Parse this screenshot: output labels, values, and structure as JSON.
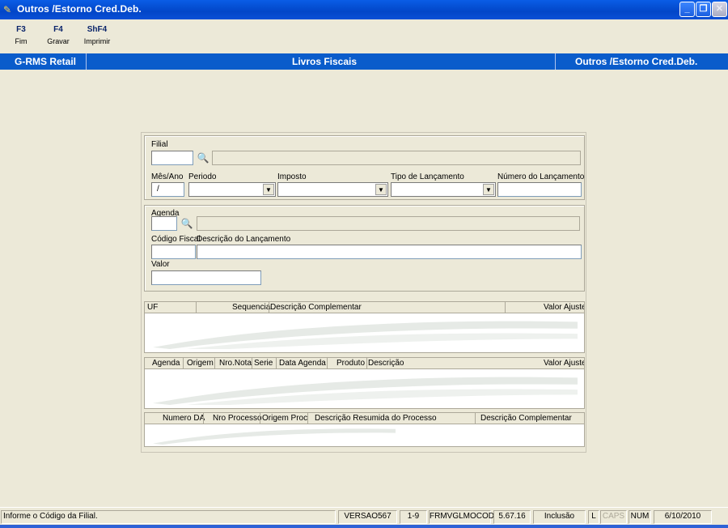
{
  "window": {
    "title": "Outros /Estorno Cred.Deb."
  },
  "fkeys": [
    {
      "key": "F3",
      "label": "Fim"
    },
    {
      "key": "F4",
      "label": "Gravar"
    },
    {
      "key": "ShF4",
      "label": "Imprimir"
    }
  ],
  "band": {
    "left": "G-RMS Retail",
    "center": "Livros Fiscais",
    "right": "Outros /Estorno Cred.Deb."
  },
  "form": {
    "filial_label": "Filial",
    "mes_ano_label": "Mês/Ano",
    "mes_ano_value": "/",
    "periodo_label": "Periodo",
    "imposto_label": "Imposto",
    "tipo_label": "Tipo de Lançamento",
    "numero_label": "Número do Lançamento",
    "agenda_label": "Agenda",
    "codigo_fiscal_label": "Código Fiscal",
    "descricao_label": "Descrição do Lançamento",
    "valor_label": "Valor"
  },
  "grid1": {
    "cols": [
      "UF",
      "Sequencia",
      "Descrição Complementar",
      "Valor Ajuste"
    ]
  },
  "grid2": {
    "cols": [
      "Agenda",
      "Origem",
      "Nro.Nota",
      "Serie",
      "Data Agenda",
      "Produto",
      "Descrição",
      "Valor Ajuste"
    ]
  },
  "grid3": {
    "cols": [
      "Numero DA",
      "Nro Processo",
      "Origem Proc",
      "Descrição Resumida do Processo",
      "Descrição Complementar"
    ]
  },
  "status": {
    "message": "Informe o Código da Filial.",
    "version": "VERSAO567",
    "range": "1-9",
    "form_code": "FRMVGLMOCOD",
    "build": "5.67.16",
    "mode": "Inclusão",
    "l": "L",
    "caps": "CAPS",
    "num": "NUM",
    "date": "6/10/2010"
  },
  "icons": {
    "binoculars": "binoculars-icon",
    "dropdown": "chevron-down-icon"
  }
}
